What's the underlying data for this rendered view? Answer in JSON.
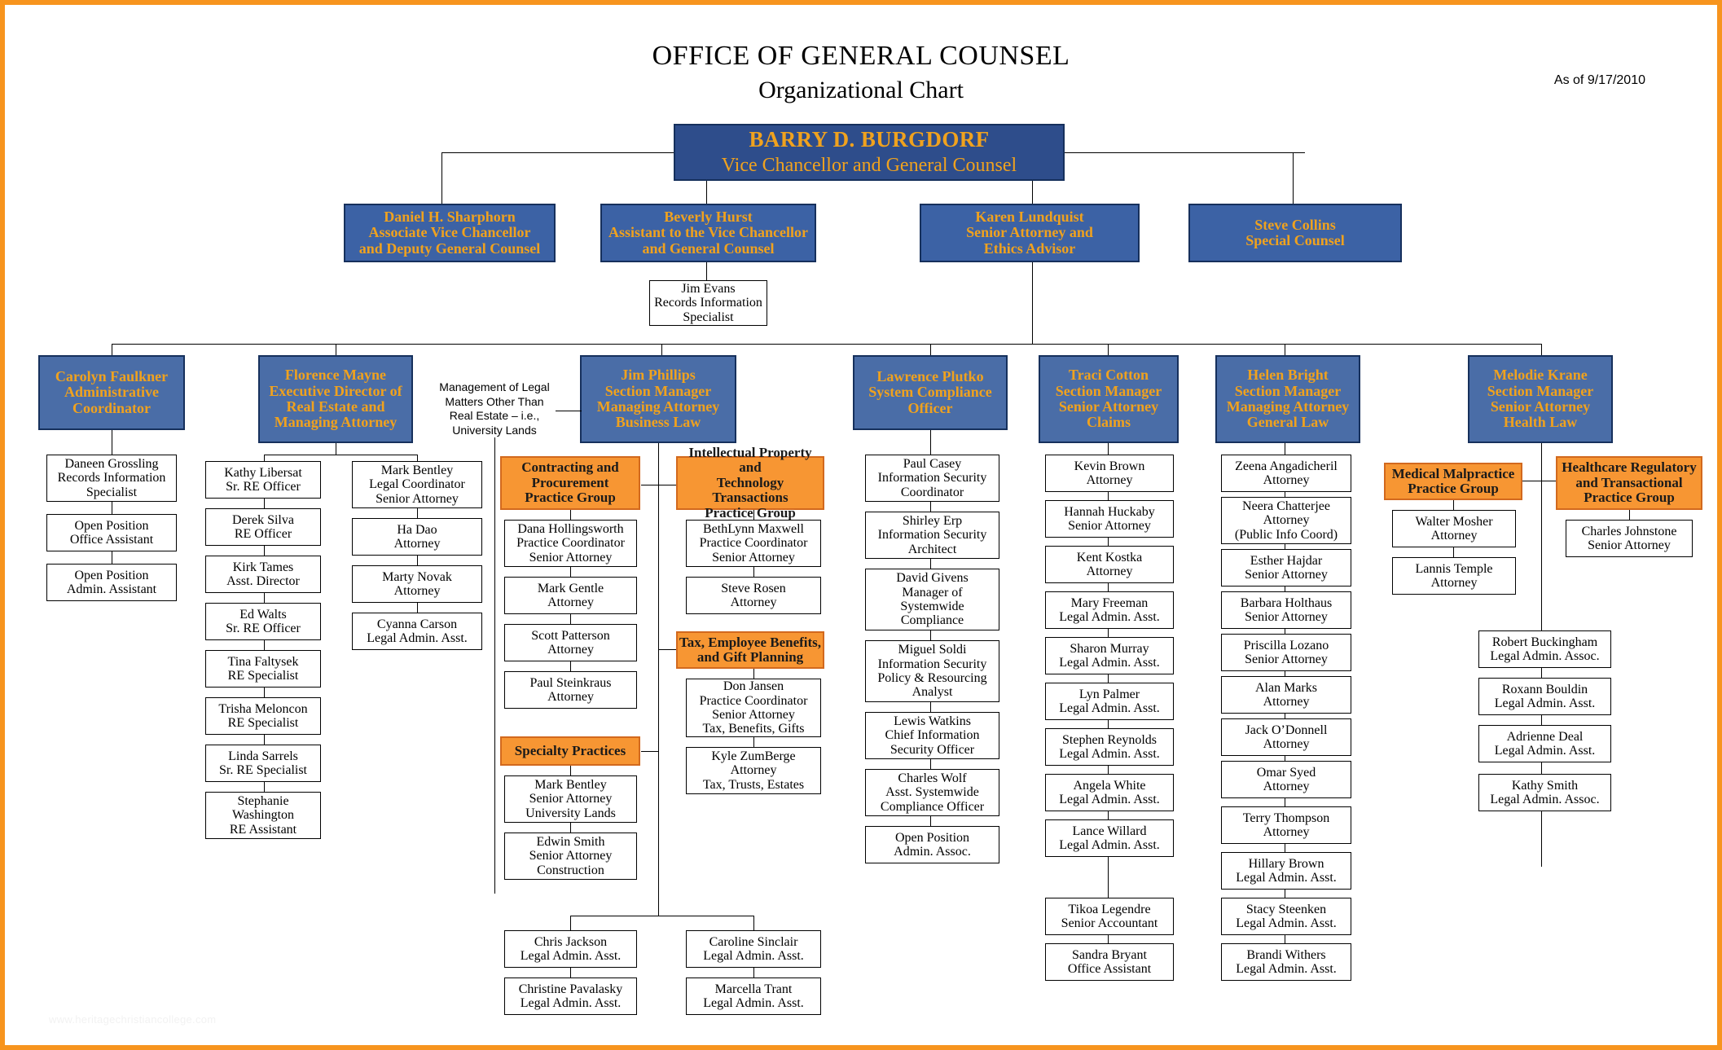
{
  "page": {
    "title_line1": "OFFICE OF GENERAL COUNSEL",
    "title_line2": "Organizational Chart",
    "as_of": "As of 9/17/2010",
    "watermark": "www.heritagechristiancollege.com",
    "colors": {
      "border": "#f7941e",
      "exec_blue": "#2e4d8b",
      "dept_blue": "#4a6da7",
      "group_orange": "#f79633",
      "gold_text": "#f0a21e"
    }
  },
  "top": {
    "name": "BARRY D. BURGDORF",
    "title": "Vice Chancellor and General Counsel"
  },
  "executives": [
    {
      "name": "Daniel H. Sharphorn",
      "line2": "Associate Vice Chancellor",
      "line3": "and Deputy General Counsel"
    },
    {
      "name": "Beverly Hurst",
      "line2": "Assistant to the Vice Chancellor",
      "line3": "and General Counsel"
    },
    {
      "name": "Karen Lundquist",
      "line2": "Senior Attorney and",
      "line3": "Ethics Advisor"
    },
    {
      "name": "Steve Collins",
      "line2": "Special Counsel",
      "line3": ""
    }
  ],
  "exec_reports": [
    {
      "name": "Jim Evans",
      "line2": "Records Information",
      "line3": "Specialist"
    }
  ],
  "annotation": {
    "l1": "Management of Legal",
    "l2": "Matters Other Than",
    "l3": "Real Estate – i.e.,",
    "l4": "University Lands"
  },
  "departments": [
    {
      "id": "admin",
      "head": {
        "l1": "Carolyn Faulkner",
        "l2": "Administrative",
        "l3": "Coordinator",
        "l4": ""
      },
      "staff": [
        {
          "l1": "Daneen Grossling",
          "l2": "Records Information",
          "l3": "Specialist"
        },
        {
          "l1": "Open Position",
          "l2": "Office Assistant",
          "l3": ""
        },
        {
          "l1": "Open Position",
          "l2": "Admin. Assistant",
          "l3": ""
        }
      ]
    },
    {
      "id": "real-estate",
      "head": {
        "l1": "Florence Mayne",
        "l2": "Executive Director of",
        "l3": "Real Estate and",
        "l4": "Managing Attorney"
      },
      "staff_col1": [
        {
          "l1": "Kathy Libersat",
          "l2": "Sr. RE Officer",
          "l3": ""
        },
        {
          "l1": "Derek Silva",
          "l2": "RE Officer",
          "l3": ""
        },
        {
          "l1": "Kirk Tames",
          "l2": "Asst. Director",
          "l3": ""
        },
        {
          "l1": "Ed Walts",
          "l2": "Sr. RE Officer",
          "l3": ""
        },
        {
          "l1": "Tina Faltysek",
          "l2": "RE Specialist",
          "l3": ""
        },
        {
          "l1": "Trisha Meloncon",
          "l2": "RE Specialist",
          "l3": ""
        },
        {
          "l1": "Linda Sarrels",
          "l2": "Sr. RE Specialist",
          "l3": ""
        },
        {
          "l1": "Stephanie",
          "l2": "Washington",
          "l3": "RE Assistant"
        }
      ],
      "staff_col2": [
        {
          "l1": "Mark Bentley",
          "l2": "Legal Coordinator",
          "l3": "Senior Attorney"
        },
        {
          "l1": "Ha Dao",
          "l2": "Attorney",
          "l3": ""
        },
        {
          "l1": "Marty Novak",
          "l2": "Attorney",
          "l3": ""
        },
        {
          "l1": "Cyanna Carson",
          "l2": "Legal Admin. Asst.",
          "l3": ""
        }
      ]
    },
    {
      "id": "business-law",
      "head": {
        "l1": "Jim Phillips",
        "l2": "Section Manager",
        "l3": "Managing Attorney",
        "l4": "Business Law"
      },
      "groups": [
        {
          "title": {
            "l1": "Contracting and",
            "l2": "Procurement",
            "l3": "Practice Group"
          },
          "members": [
            {
              "l1": "Dana Hollingsworth",
              "l2": "Practice Coordinator",
              "l3": "Senior Attorney"
            },
            {
              "l1": "Mark Gentle",
              "l2": "Attorney",
              "l3": ""
            },
            {
              "l1": "Scott Patterson",
              "l2": "Attorney",
              "l3": ""
            },
            {
              "l1": "Paul Steinkraus",
              "l2": "Attorney",
              "l3": ""
            }
          ]
        },
        {
          "title": {
            "l1": "Specialty Practices",
            "l2": "",
            "l3": ""
          },
          "members": [
            {
              "l1": "Mark Bentley",
              "l2": "Senior Attorney",
              "l3": "University Lands"
            },
            {
              "l1": "Edwin Smith",
              "l2": "Senior Attorney",
              "l3": "Construction"
            }
          ]
        },
        {
          "title": {
            "l1": "Intellectual Property and",
            "l2": "Technology Transactions",
            "l3": "Practice Group"
          },
          "members": [
            {
              "l1": "BethLynn Maxwell",
              "l2": "Practice Coordinator",
              "l3": "Senior Attorney"
            },
            {
              "l1": "Steve Rosen",
              "l2": "Attorney",
              "l3": ""
            }
          ]
        },
        {
          "title": {
            "l1": "Tax, Employee Benefits,",
            "l2": "and Gift Planning",
            "l3": ""
          },
          "members": [
            {
              "l1": "Don Jansen",
              "l2": "Practice Coordinator",
              "l3": "Senior Attorney",
              "l4": "Tax, Benefits, Gifts"
            },
            {
              "l1": "Kyle ZumBerge",
              "l2": "Attorney",
              "l3": "Tax, Trusts, Estates"
            }
          ]
        }
      ],
      "admin_left": [
        {
          "l1": "Chris Jackson",
          "l2": "Legal Admin. Asst.",
          "l3": ""
        },
        {
          "l1": "Christine Pavalasky",
          "l2": "Legal Admin. Asst.",
          "l3": ""
        }
      ],
      "admin_right": [
        {
          "l1": "Caroline Sinclair",
          "l2": "Legal Admin. Asst.",
          "l3": ""
        },
        {
          "l1": "Marcella Trant",
          "l2": "Legal Admin. Asst.",
          "l3": ""
        }
      ]
    },
    {
      "id": "compliance",
      "head": {
        "l1": "Lawrence Plutko",
        "l2": "System Compliance",
        "l3": "Officer",
        "l4": ""
      },
      "staff": [
        {
          "l1": "Paul Casey",
          "l2": "Information Security",
          "l3": "Coordinator"
        },
        {
          "l1": "Shirley Erp",
          "l2": "Information Security",
          "l3": "Architect"
        },
        {
          "l1": "David Givens",
          "l2": "Manager of",
          "l3": "Systemwide",
          "l4": "Compliance"
        },
        {
          "l1": "Miguel Soldi",
          "l2": "Information Security",
          "l3": "Policy & Resourcing",
          "l4": "Analyst"
        },
        {
          "l1": "Lewis Watkins",
          "l2": "Chief Information",
          "l3": "Security Officer"
        },
        {
          "l1": "Charles Wolf",
          "l2": "Asst. Systemwide",
          "l3": "Compliance Officer"
        },
        {
          "l1": "Open Position",
          "l2": "Admin. Assoc.",
          "l3": ""
        }
      ]
    },
    {
      "id": "claims",
      "head": {
        "l1": "Traci Cotton",
        "l2": "Section Manager",
        "l3": "Senior Attorney",
        "l4": "Claims"
      },
      "staff": [
        {
          "l1": "Kevin Brown",
          "l2": "Attorney",
          "l3": ""
        },
        {
          "l1": "Hannah Huckaby",
          "l2": "Senior Attorney",
          "l3": ""
        },
        {
          "l1": "Kent Kostka",
          "l2": "Attorney",
          "l3": ""
        },
        {
          "l1": "Mary Freeman",
          "l2": "Legal Admin. Asst.",
          "l3": ""
        },
        {
          "l1": "Sharon Murray",
          "l2": "Legal Admin. Asst.",
          "l3": ""
        },
        {
          "l1": "Lyn Palmer",
          "l2": "Legal Admin. Asst.",
          "l3": ""
        },
        {
          "l1": "Stephen Reynolds",
          "l2": "Legal Admin. Asst.",
          "l3": ""
        },
        {
          "l1": "Angela White",
          "l2": "Legal Admin. Asst.",
          "l3": ""
        },
        {
          "l1": "Lance Willard",
          "l2": "Legal Admin. Asst.",
          "l3": ""
        },
        {
          "l1": "Tikoa Legendre",
          "l2": "Senior Accountant",
          "l3": ""
        },
        {
          "l1": "Sandra Bryant",
          "l2": "Office Assistant",
          "l3": ""
        }
      ]
    },
    {
      "id": "general-law",
      "head": {
        "l1": "Helen Bright",
        "l2": "Section Manager",
        "l3": "Managing Attorney",
        "l4": "General Law"
      },
      "staff": [
        {
          "l1": "Zeena Angadicheril",
          "l2": "Attorney",
          "l3": ""
        },
        {
          "l1": "Neera Chatterjee",
          "l2": "Attorney",
          "l3": "(Public Info Coord)"
        },
        {
          "l1": "Esther Hajdar",
          "l2": "Senior Attorney",
          "l3": ""
        },
        {
          "l1": "Barbara Holthaus",
          "l2": "Senior Attorney",
          "l3": ""
        },
        {
          "l1": "Priscilla Lozano",
          "l2": "Senior Attorney",
          "l3": ""
        },
        {
          "l1": "Alan Marks",
          "l2": "Attorney",
          "l3": ""
        },
        {
          "l1": "Jack O’Donnell",
          "l2": "Attorney",
          "l3": ""
        },
        {
          "l1": "Omar Syed",
          "l2": "Attorney",
          "l3": ""
        },
        {
          "l1": "Terry Thompson",
          "l2": "Attorney",
          "l3": ""
        },
        {
          "l1": "Hillary Brown",
          "l2": "Legal Admin. Asst.",
          "l3": ""
        },
        {
          "l1": "Stacy Steenken",
          "l2": "Legal Admin. Asst.",
          "l3": ""
        },
        {
          "l1": "Brandi Withers",
          "l2": "Legal Admin. Asst.",
          "l3": ""
        }
      ]
    },
    {
      "id": "health-law",
      "head": {
        "l1": "Melodie Krane",
        "l2": "Section Manager",
        "l3": "Senior Attorney",
        "l4": "Health Law"
      },
      "groups": [
        {
          "title": {
            "l1": "Medical Malpractice",
            "l2": "Practice Group",
            "l3": ""
          },
          "members": [
            {
              "l1": "Walter Mosher",
              "l2": "Attorney",
              "l3": ""
            },
            {
              "l1": "Lannis Temple",
              "l2": "Attorney",
              "l3": ""
            }
          ]
        },
        {
          "title": {
            "l1": "Healthcare Regulatory",
            "l2": "and Transactional",
            "l3": "Practice Group"
          },
          "members": [
            {
              "l1": "Charles Johnstone",
              "l2": "Senior Attorney",
              "l3": ""
            }
          ]
        }
      ],
      "admin": [
        {
          "l1": "Robert Buckingham",
          "l2": "Legal Admin. Assoc.",
          "l3": ""
        },
        {
          "l1": "Roxann Bouldin",
          "l2": "Legal Admin. Asst.",
          "l3": ""
        },
        {
          "l1": "Adrienne Deal",
          "l2": "Legal Admin. Asst.",
          "l3": ""
        },
        {
          "l1": "Kathy Smith",
          "l2": "Legal Admin. Assoc.",
          "l3": ""
        }
      ]
    }
  ]
}
